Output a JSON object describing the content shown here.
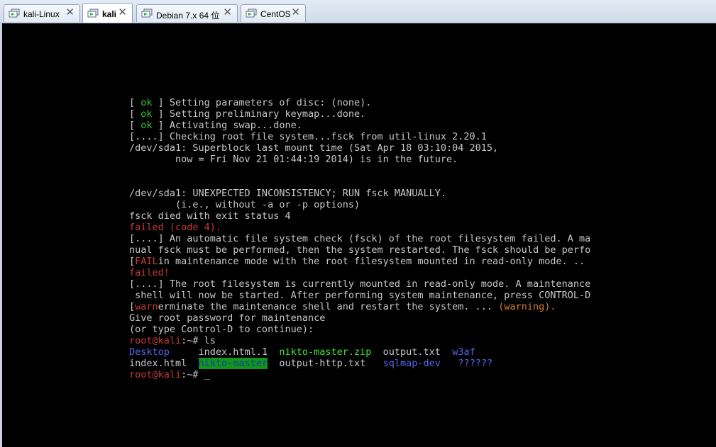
{
  "tabs": [
    {
      "label": "kali-Linux",
      "close": "✕",
      "active": false
    },
    {
      "label": "kali",
      "close": "✕",
      "active": true
    },
    {
      "label": "Debian 7.x 64 位",
      "close": "✕",
      "active": false
    },
    {
      "label": "CentOS",
      "close": "✕",
      "active": false
    }
  ],
  "colors": {
    "ok": "#2ec82e",
    "error": "#c43a3a",
    "warning": "#d17c2c",
    "directory": "#5864ee",
    "archive": "#44e23e",
    "highlight_bg": "#109618"
  },
  "terminal": {
    "lines": [
      [
        {
          "t": "[ "
        },
        {
          "t": "ok",
          "c": "ok"
        },
        {
          "t": " ] Setting parameters of disc: (none)."
        }
      ],
      [
        {
          "t": "[ "
        },
        {
          "t": "ok",
          "c": "ok"
        },
        {
          "t": " ] Setting preliminary keymap...done."
        }
      ],
      [
        {
          "t": "[ "
        },
        {
          "t": "ok",
          "c": "ok"
        },
        {
          "t": " ] Activating swap...done."
        }
      ],
      [
        {
          "t": "[....] Checking root file system...fsck from util-linux 2.20.1"
        }
      ],
      [
        {
          "t": "/dev/sda1: Superblock last mount time (Sat Apr 18 03:10:04 2015,"
        }
      ],
      [
        {
          "t": "        now = Fri Nov 21 01:44:19 2014) is in the future."
        }
      ],
      [],
      [],
      [
        {
          "t": "/dev/sda1: UNEXPECTED INCONSISTENCY; RUN fsck MANUALLY."
        }
      ],
      [
        {
          "t": "        (i.e., without -a or -p options)"
        }
      ],
      [
        {
          "t": "fsck died with exit status 4"
        }
      ],
      [
        {
          "t": "failed (code 4).",
          "c": "red"
        }
      ],
      [
        {
          "t": "[....] An automatic file system check (fsck) of the root filesystem failed. A ma"
        }
      ],
      [
        {
          "t": "nual fsck must be performed, then the system restarted. The fsck should be perfo"
        }
      ],
      [
        {
          "t": "["
        },
        {
          "t": "FAIL",
          "c": "red"
        },
        {
          "t": "in maintenance mode with the root filesystem mounted in read-only mode. .."
        }
      ],
      [
        {
          "t": "failed!",
          "c": "red"
        }
      ],
      [
        {
          "t": "[....] The root filesystem is currently mounted in read-only mode. A maintenance"
        }
      ],
      [
        {
          "t": " shell will now be started. After performing system maintenance, press CONTROL-D"
        }
      ],
      [
        {
          "t": "["
        },
        {
          "t": "warn",
          "c": "red"
        },
        {
          "t": "erminate the maintenance shell and restart the system. ... "
        },
        {
          "t": "(warning).",
          "c": "orange"
        }
      ],
      [
        {
          "t": "Give root password for maintenance"
        }
      ],
      [
        {
          "t": "(or type Control-D to continue):"
        }
      ],
      [
        {
          "t": "root@kali",
          "c": "red"
        },
        {
          "t": ":~# ls"
        }
      ],
      [
        {
          "t": "Desktop",
          "c": "blue"
        },
        {
          "t": "     index.html.1  "
        },
        {
          "t": "nikto-master.zip",
          "c": "green"
        },
        {
          "t": "  output.txt  "
        },
        {
          "t": "w3af",
          "c": "blue"
        }
      ],
      [
        {
          "t": "index.html  "
        },
        {
          "t": "nikto-master",
          "c": "hl"
        },
        {
          "t": "  output-http.txt   "
        },
        {
          "t": "sqlmap-dev",
          "c": "blue"
        },
        {
          "t": "   "
        },
        {
          "t": "??????",
          "c": "blue"
        }
      ],
      [
        {
          "t": "root@kali",
          "c": "red"
        },
        {
          "t": ":~# "
        },
        {
          "t": "_",
          "c": "cursor"
        }
      ]
    ]
  }
}
